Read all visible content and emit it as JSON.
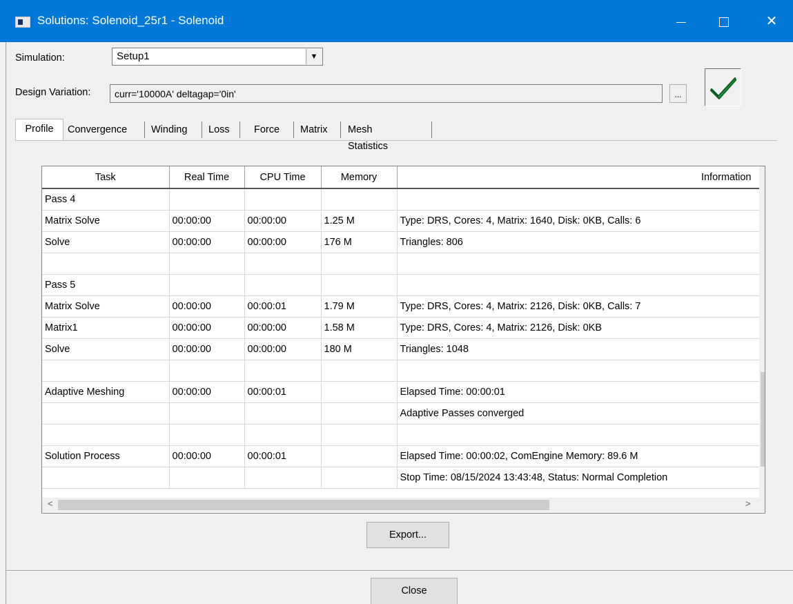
{
  "window": {
    "title": "Solutions: Solenoid_25r1 - Solenoid",
    "minimize": "—",
    "maximize": "☐",
    "close": "✕"
  },
  "simulation": {
    "label": "Simulation:",
    "value": "Setup1"
  },
  "design_variation": {
    "label": "Design Variation:",
    "value": "curr='10000A' deltagap='0in'",
    "browse_label": "..."
  },
  "status": {
    "icon": "check-icon",
    "color": "#22b14c"
  },
  "tabs": [
    {
      "label": "Profile"
    },
    {
      "label": "Convergence"
    },
    {
      "label": "Winding"
    },
    {
      "label": "Loss"
    },
    {
      "label": "Force"
    },
    {
      "label": "Matrix"
    },
    {
      "label": "Mesh Statistics"
    }
  ],
  "table": {
    "headers": [
      "Task",
      "Real Time",
      "CPU Time",
      "Memory",
      "Information"
    ],
    "rows": [
      [
        "Pass 4",
        "",
        "",
        "",
        ""
      ],
      [
        "Matrix Solve",
        "00:00:00",
        "00:00:00",
        "1.25 M",
        "Type: DRS, Cores: 4, Matrix: 1640, Disk: 0KB, Calls: 6"
      ],
      [
        "Solve",
        "00:00:00",
        "00:00:00",
        "176 M",
        "Triangles: 806"
      ],
      [
        "",
        "",
        "",
        "",
        ""
      ],
      [
        "Pass 5",
        "",
        "",
        "",
        ""
      ],
      [
        "Matrix Solve",
        "00:00:00",
        "00:00:01",
        "1.79 M",
        "Type: DRS, Cores: 4, Matrix: 2126, Disk: 0KB, Calls: 7"
      ],
      [
        "Matrix1",
        "00:00:00",
        "00:00:00",
        "1.58 M",
        "Type: DRS, Cores: 4, Matrix: 2126, Disk: 0KB"
      ],
      [
        "Solve",
        "00:00:00",
        "00:00:00",
        "180 M",
        "Triangles: 1048"
      ],
      [
        "",
        "",
        "",
        "",
        ""
      ],
      [
        "Adaptive Meshing",
        "00:00:00",
        "00:00:01",
        "",
        "Elapsed Time: 00:00:01"
      ],
      [
        "",
        "",
        "",
        "",
        "Adaptive Passes converged"
      ],
      [
        "",
        "",
        "",
        "",
        ""
      ],
      [
        "Solution Process",
        "00:00:00",
        "00:00:01",
        "",
        "Elapsed Time: 00:00:02, ComEngine Memory: 89.6 M"
      ],
      [
        "",
        "",
        "",
        "",
        "Stop Time: 08/15/2024 13:43:48, Status: Normal Completion"
      ]
    ]
  },
  "buttons": {
    "export": "Export...",
    "close": "Close"
  }
}
